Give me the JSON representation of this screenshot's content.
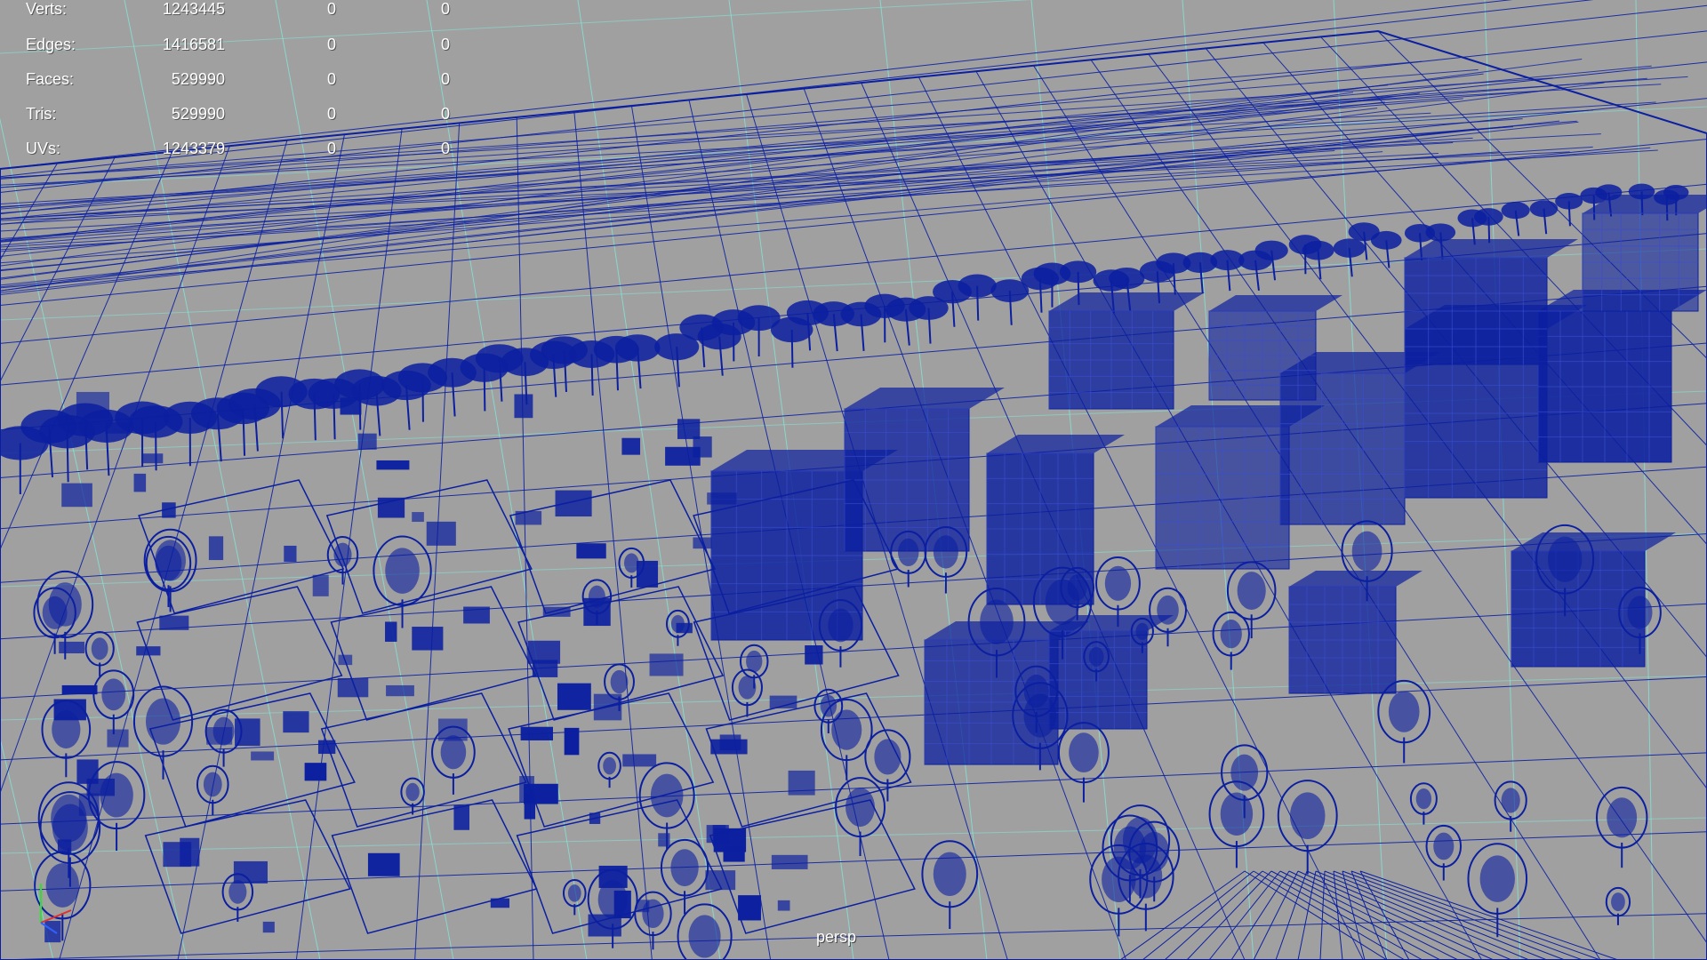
{
  "hud": {
    "rows": [
      {
        "label": "Verts:",
        "total": "1243445",
        "selected": "0",
        "selected2": "0"
      },
      {
        "label": "Edges:",
        "total": "1416581",
        "selected": "0",
        "selected2": "0"
      },
      {
        "label": "Faces:",
        "total": "529990",
        "selected": "0",
        "selected2": "0"
      },
      {
        "label": "Tris:",
        "total": "529990",
        "selected": "0",
        "selected2": "0"
      },
      {
        "label": "UVs:",
        "total": "1243379",
        "selected": "0",
        "selected2": "0"
      }
    ]
  },
  "viewport": {
    "camera": "persp",
    "background": "#a0a0a0",
    "wire_color": "#0b1fa0",
    "grid_color": "#7ff0e0"
  },
  "axis_gizmo": {
    "x_color": "#e03030",
    "y_color": "#30e030",
    "z_color": "#3060ff"
  }
}
